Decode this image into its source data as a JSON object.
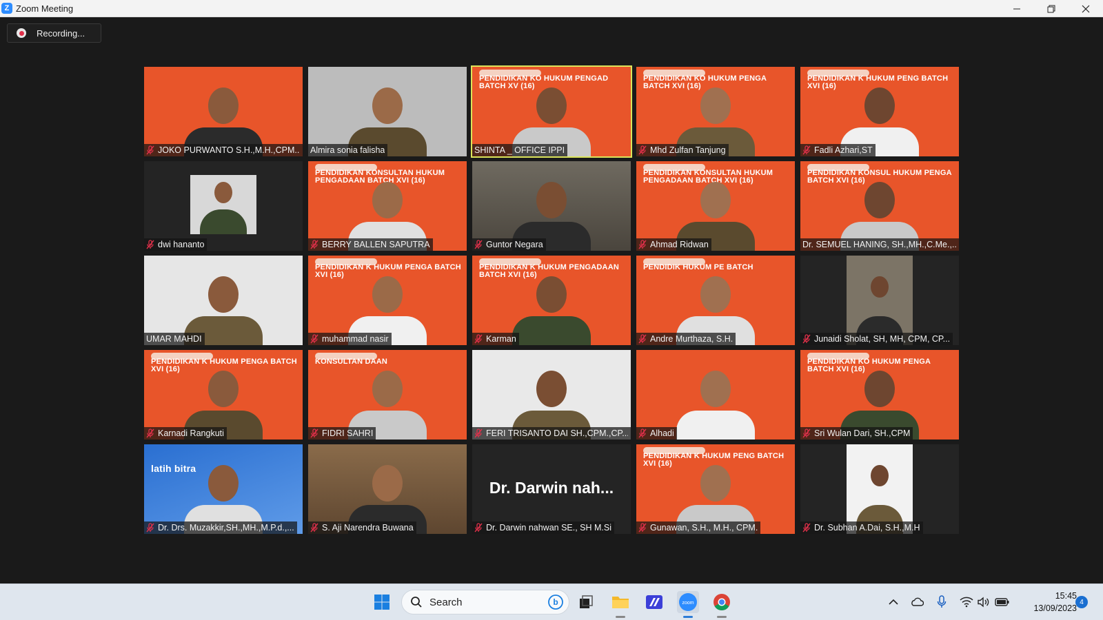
{
  "window": {
    "title": "Zoom Meeting",
    "logo_letter": "Z"
  },
  "recording": {
    "label": "Recording..."
  },
  "colors": {
    "active_speaker": "#dbe45a",
    "mic_muted": "#e0304a",
    "banner_orange": "#e8552a"
  },
  "participants": [
    {
      "name": "JOKO PURWANTO S.H.,M.H.,CPM...",
      "muted": true,
      "bg": "orange",
      "banner": ""
    },
    {
      "name": "Almira sonia falisha",
      "muted": false,
      "bg": "gray",
      "banner": ""
    },
    {
      "name": "SHINTA _ OFFICE IPPI",
      "muted": false,
      "bg": "orange",
      "active": true,
      "banner": "PENDIDIKAN KO HUKUM PENGAD BATCH XV (16)"
    },
    {
      "name": "Mhd Zulfan Tanjung",
      "muted": true,
      "bg": "orange",
      "banner": "PENDIDIKAN KO HUKUM PENGA BATCH XVI (16)"
    },
    {
      "name": "Fadli Azhari,ST",
      "muted": true,
      "bg": "orange",
      "banner": "PENDIDIKAN K HUKUM PENG BATCH XVI (16)"
    },
    {
      "name": "dwi hananto",
      "muted": true,
      "bg": "dark",
      "banner": ""
    },
    {
      "name": "BERRY BALLEN SAPUTRA",
      "muted": true,
      "bg": "orange",
      "banner": "PENDIDIKAN KONSULTAN HUKUM PENGADAAN BATCH XVI (16)"
    },
    {
      "name": "Guntor Negara",
      "muted": true,
      "bg": "room",
      "banner": ""
    },
    {
      "name": "Ahmad Ridwan",
      "muted": true,
      "bg": "orange",
      "banner": "PENDIDIKAN KONSULTAN HUKUM PENGADAAN BATCH XVI (16)"
    },
    {
      "name": "Dr. SEMUEL HANING, SH.,MH.,C.Me.,...",
      "muted": false,
      "bg": "orange",
      "banner": "PENDIDIKAN KONSUL HUKUM PENGA BATCH XVI (16)"
    },
    {
      "name": "UMAR MAHDI",
      "muted": false,
      "bg": "paper",
      "banner": ""
    },
    {
      "name": "muhammad nasir",
      "muted": true,
      "bg": "orange",
      "banner": "PENDIDIKAN K HUKUM PENGA BATCH XVI (16)"
    },
    {
      "name": "Karman",
      "muted": true,
      "bg": "orange",
      "banner": "PENDIDIKAN K HUKUM PENGADAAN BATCH XVI (16)"
    },
    {
      "name": "Andre Murthaza, S.H.",
      "muted": true,
      "bg": "orange",
      "banner": "PENDIDIK HUKUM PE BATCH"
    },
    {
      "name": "Junaidi Sholat, SH, MH, CPM, CP...",
      "muted": true,
      "bg": "dark",
      "banner": ""
    },
    {
      "name": "Karnadi Rangkuti",
      "muted": true,
      "bg": "orange",
      "banner": "PENDIDIKAN K HUKUM PENGA BATCH XVI (16)"
    },
    {
      "name": "FIDRI SAHRI",
      "muted": true,
      "bg": "orange",
      "banner": "KONSULTAN DAAN"
    },
    {
      "name": "FERI TRISANTO DAI SH.,CPM.,CP...",
      "muted": true,
      "bg": "white",
      "banner": ""
    },
    {
      "name": "Alhadi",
      "muted": true,
      "bg": "orange",
      "banner": ""
    },
    {
      "name": "Sri Wulan Dari, SH.,CPM",
      "muted": true,
      "bg": "orange",
      "banner": "PENDIDIKAN KO HUKUM PENGA BATCH XVI (16)"
    },
    {
      "name": "Dr. Drs. Muzakkir,SH.,MH.,M.P.d.,...",
      "muted": true,
      "bg": "blue",
      "banner": "latih bitra"
    },
    {
      "name": "S. Aji Narendra Buwana",
      "muted": true,
      "bg": "wood",
      "banner": ""
    },
    {
      "name": "Dr. Darwin nahwan SE., SH M.Si",
      "muted": true,
      "bg": "dark",
      "banner": "",
      "display_name": "Dr. Darwin nah..."
    },
    {
      "name": "Gunawan, S.H., M.H., CPM.",
      "muted": true,
      "bg": "orange",
      "banner": "PENDIDIKAN K HUKUM PENG BATCH XVI (16)"
    },
    {
      "name": "Dr. Subhan A.Dai, S.H.,M.H",
      "muted": true,
      "bg": "dark",
      "banner": ""
    }
  ],
  "taskbar": {
    "search_label": "Search",
    "apps": [
      "windows-start",
      "search",
      "bing",
      "task-view",
      "file-explorer",
      "ms-365",
      "zoom",
      "chrome"
    ],
    "clock_time": "15:45",
    "clock_date": "13/09/2023",
    "notification_count": "4"
  }
}
